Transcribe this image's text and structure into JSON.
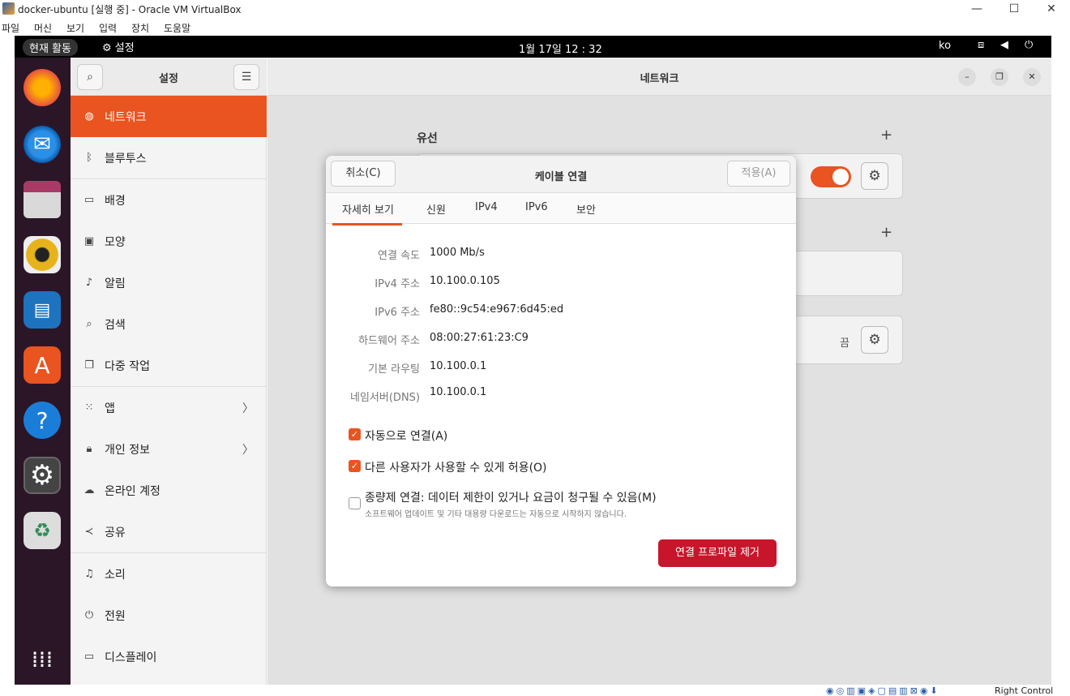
{
  "vbox": {
    "title": "docker-ubuntu [실행 중] - Oracle VM VirtualBox",
    "minimize": "—",
    "maximize": "☐",
    "close": "✕",
    "menu": [
      "파일",
      "머신",
      "보기",
      "입력",
      "장치",
      "도움말"
    ],
    "status_text": "Right Control"
  },
  "topbar": {
    "activities": "현재 활동",
    "app_name": "설정",
    "clock": "1월 17일  12 : 32",
    "lang": "ko",
    "net_icon": "network-icon",
    "vol_icon": "volume-icon",
    "power_icon": "power-icon"
  },
  "dock": {
    "items": [
      "firefox-icon",
      "thunderbird-icon",
      "files-icon",
      "rhythmbox-icon",
      "writer-icon",
      "app-center-icon",
      "help-icon",
      "settings-icon",
      "trash-icon",
      "apps-grid-icon"
    ]
  },
  "sidebar": {
    "title": "설정",
    "items": [
      {
        "label": "네트워크",
        "icon": "globe-icon"
      },
      {
        "label": "블루투스",
        "icon": "bluetooth-icon"
      },
      {
        "label": "배경",
        "icon": "monitor-icon"
      },
      {
        "label": "모양",
        "icon": "appearance-icon"
      },
      {
        "label": "알림",
        "icon": "bell-icon"
      },
      {
        "label": "검색",
        "icon": "search-icon"
      },
      {
        "label": "다중 작업",
        "icon": "multitask-icon"
      },
      {
        "label": "앱",
        "icon": "apps-icon"
      },
      {
        "label": "개인 정보",
        "icon": "lock-icon"
      },
      {
        "label": "온라인 계정",
        "icon": "cloud-icon"
      },
      {
        "label": "공유",
        "icon": "share-icon"
      },
      {
        "label": "소리",
        "icon": "music-icon"
      },
      {
        "label": "전원",
        "icon": "power-icon"
      },
      {
        "label": "디스플레이",
        "icon": "display-icon"
      }
    ]
  },
  "main": {
    "title": "네트워크",
    "wired_label": "유선",
    "plus": "+",
    "off_label": "끔"
  },
  "dialog": {
    "cancel": "취소(C)",
    "title": "케이블 연결",
    "apply": "적용(A)",
    "tabs": [
      "자세히 보기",
      "신원",
      "IPv4",
      "IPv6",
      "보안"
    ],
    "rows": [
      {
        "label": "연결 속도",
        "value": "1000 Mb/s"
      },
      {
        "label": "IPv4 주소",
        "value": "10.100.0.105"
      },
      {
        "label": "IPv6 주소",
        "value": "fe80::9c54:e967:6d45:ed"
      },
      {
        "label": "하드웨어 주소",
        "value": "08:00:27:61:23:C9"
      },
      {
        "label": "기본 라우팅",
        "value": "10.100.0.1"
      },
      {
        "label": "네임서버(DNS)",
        "value": "10.100.0.1"
      }
    ],
    "auto_connect": "자동으로 연결(A)",
    "allow_others": "다른 사용자가 사용할 수 있게 허용(O)",
    "metered": "종량제 연결: 데이터 제한이 있거나 요금이 청구될 수 있음(M)",
    "metered_desc": "소프트웨어 업데이트 및 기타 대용량 다운로드는 자동으로 시작하지 않습니다.",
    "remove_profile": "연결 프로파일 제거"
  }
}
